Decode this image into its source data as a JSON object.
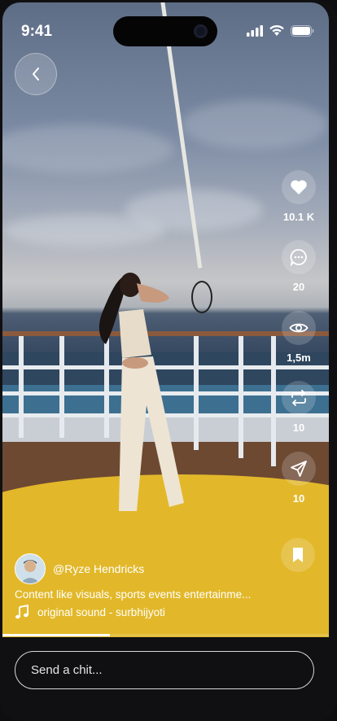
{
  "status_bar": {
    "time": "9:41",
    "icons": [
      "cellular-signal-icon",
      "wifi-icon",
      "battery-icon"
    ]
  },
  "navigation": {
    "back_icon": "chevron-left-icon"
  },
  "actions": [
    {
      "name": "like",
      "icon": "heart-icon",
      "count": "10.1 K"
    },
    {
      "name": "comment",
      "icon": "comment-bubble-icon",
      "count": "20"
    },
    {
      "name": "views",
      "icon": "eye-icon",
      "count": "1,5m"
    },
    {
      "name": "repost",
      "icon": "repost-icon",
      "count": "10"
    },
    {
      "name": "share",
      "icon": "send-icon",
      "count": "10"
    }
  ],
  "bookmark": {
    "icon": "bookmark-icon"
  },
  "post": {
    "author": "@Ryze Hendricks",
    "caption": "Content like visuals, sports events entertainme...",
    "sound": "original sound - surbhijyoti",
    "sound_icon": "music-note-icon",
    "progress": 0.33
  },
  "chat_input": {
    "placeholder": "Send a chit...",
    "value": ""
  }
}
